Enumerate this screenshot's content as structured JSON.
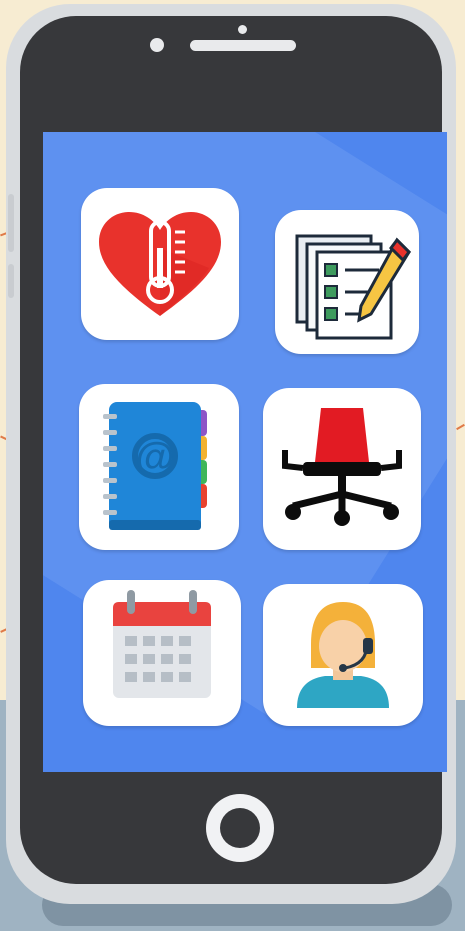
{
  "screen": {
    "apps": [
      {
        "icon": "health-thermometer-heart-icon",
        "accent": "#e8322c"
      },
      {
        "icon": "checklist-pencil-icon",
        "accent": "#3e9b5e"
      },
      {
        "icon": "address-book-icon",
        "accent": "#1f86d8"
      },
      {
        "icon": "office-chair-icon",
        "accent": "#e21b23"
      },
      {
        "icon": "calendar-icon",
        "accent": "#e9433f"
      },
      {
        "icon": "support-agent-headset-icon",
        "accent": "#f4b13a"
      }
    ],
    "background": "#4f86ee"
  },
  "phone": {
    "body_color": "#37383b",
    "frame_color": "#d9dcdf"
  }
}
